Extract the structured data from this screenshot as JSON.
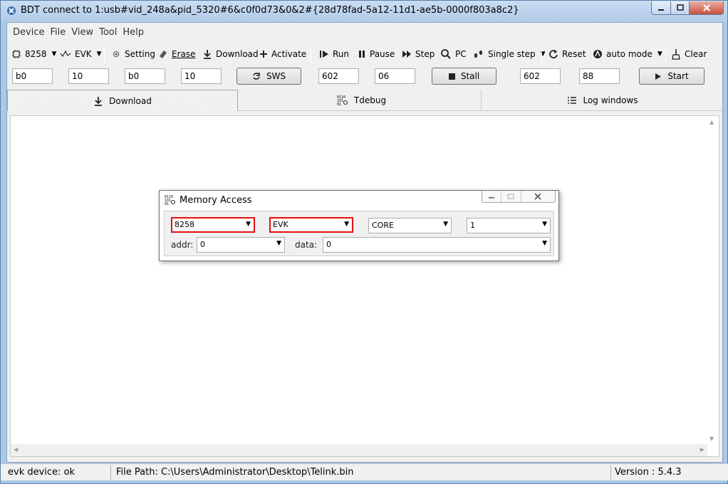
{
  "window": {
    "title": "BDT connect to 1:usb#vid_248a&pid_5320#6&c0f0d73&0&2#{28d78fad-5a12-11d1-ae5b-0000f803a8c2}"
  },
  "menu": [
    "Device",
    "File",
    "View",
    "Tool",
    "Help"
  ],
  "toolbar": {
    "chip": "8258",
    "board": "EVK",
    "setting": "Setting",
    "erase": "Erase",
    "download": "Download",
    "activate": "Activate",
    "run": "Run",
    "pause": "Pause",
    "step": "Step",
    "pc": "PC",
    "single_step": "Single step",
    "reset": "Reset",
    "auto_mode": "auto mode",
    "clear": "Clear"
  },
  "params": {
    "f1": "b0",
    "f2": "10",
    "f3": "b0",
    "f4": "10",
    "sws": "SWS",
    "f5": "602",
    "f6": "06",
    "stall": "Stall",
    "f7": "602",
    "f8": "88",
    "start": "Start"
  },
  "tabs": [
    "Download",
    "Tdebug",
    "Log windows"
  ],
  "dialog": {
    "title": "Memory Access",
    "chip": "8258",
    "board": "EVK",
    "region": "CORE",
    "size": "1",
    "addr_label": "addr:",
    "addr": "0",
    "data_label": "data:",
    "data": "0"
  },
  "status": {
    "device": "evk device: ok",
    "file_path": "File Path:  C:\\Users\\Administrator\\Desktop\\Telink.bin",
    "version": "Version : 5.4.3"
  },
  "colors": {
    "highlight": "#e01010",
    "titlebar": "#b9d1ea"
  }
}
